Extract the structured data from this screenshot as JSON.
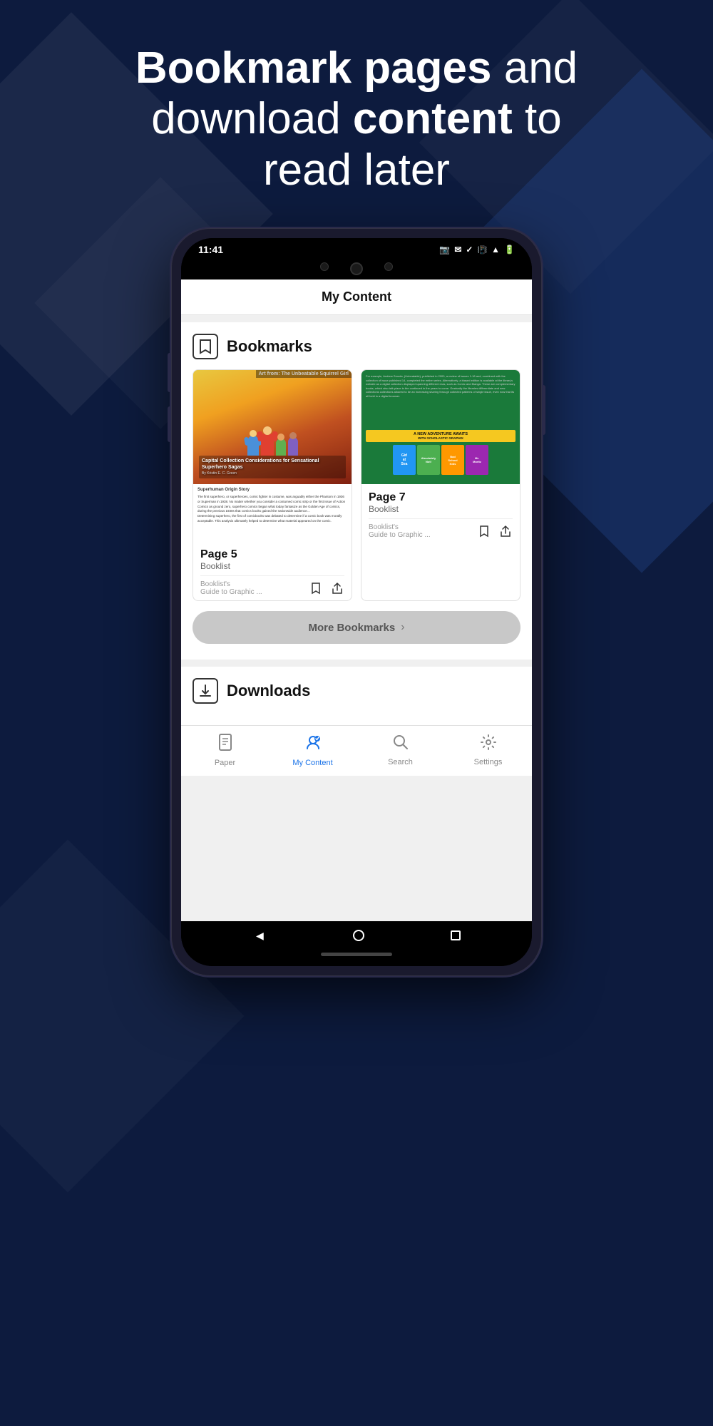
{
  "hero": {
    "title_bold": "Bookmark pages",
    "title_regular": " and\ndownload content to\nread later"
  },
  "status_bar": {
    "time": "11:41",
    "icons": "📷 ✉ ✓"
  },
  "app": {
    "title": "My Content"
  },
  "bookmarks": {
    "section_title": "Bookmarks",
    "card1": {
      "page": "Page 5",
      "source": "Booklist",
      "publication": "Booklist's Guide to Graphic ...",
      "image_title": "Capital Collection Considerations for Sensational Superhero Sagas",
      "author": "By Kristin E. C. Green"
    },
    "card2": {
      "page": "Page 7",
      "source": "Booklist",
      "publication": "Booklist's Guide to Graphic ...",
      "image_text": "A NEW ADVENTURE AWAITS WITH SCHOLASTIC GRAPHIX"
    },
    "more_button": "More Bookmarks"
  },
  "downloads": {
    "section_title": "Downloads"
  },
  "bottom_nav": {
    "items": [
      {
        "label": "Paper",
        "active": false
      },
      {
        "label": "My Content",
        "active": true
      },
      {
        "label": "Search",
        "active": false
      },
      {
        "label": "Settings",
        "active": false
      }
    ]
  }
}
